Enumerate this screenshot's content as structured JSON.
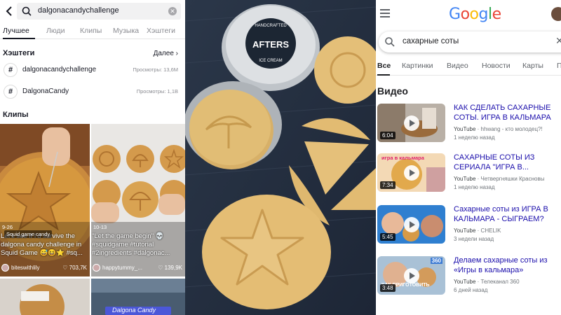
{
  "tiktok": {
    "search_query": "dalgonacandychallenge",
    "tabs": [
      "Лучшее",
      "Люди",
      "Клипы",
      "Музыка",
      "Хэштеги"
    ],
    "active_tab": "Лучшее",
    "hashtags_title": "Хэштеги",
    "more_label": "Далее",
    "hashtags": [
      {
        "name": "dalgonacandychallenge",
        "views": "Просмотры: 13,6M"
      },
      {
        "name": "DalgonaCandy",
        "views": "Просмотры: 1,1B"
      }
    ],
    "clips_title": "Клипы",
    "clips": [
      {
        "date": "9-26",
        "tag": "Squid game candy",
        "caption": "Let's see if I'd survive the dalgona candy challenge in Squid Game 😅😆⭐ #sq...",
        "user": "biteswithlily",
        "likes": "703,7K"
      },
      {
        "date": "10-13",
        "caption": "\"Let the game begin\" 💀 #squidgame #tutorial #2ingredients #dalgonac...",
        "user": "happytummy_...",
        "likes": "139,9K"
      }
    ],
    "clip_bottom_text": "Dalgona Candy"
  },
  "photo": {
    "tin_lid_line1": "HANDCRAFTED",
    "tin_lid_brand": "AFTERS",
    "tin_lid_line2": "ICE CREAM"
  },
  "google": {
    "logo_letters": [
      {
        "ch": "G",
        "color": "#4285F4"
      },
      {
        "ch": "o",
        "color": "#EA4335"
      },
      {
        "ch": "o",
        "color": "#FBBC05"
      },
      {
        "ch": "g",
        "color": "#4285F4"
      },
      {
        "ch": "l",
        "color": "#34A853"
      },
      {
        "ch": "e",
        "color": "#EA4335"
      }
    ],
    "search_query": "сахарные соты",
    "tabs": [
      "Все",
      "Картинки",
      "Видео",
      "Новости",
      "Карты",
      "П"
    ],
    "active_tab": "Все",
    "videos_title": "Видео",
    "videos": [
      {
        "title": "КАК СДЕЛАТЬ САХАРНЫЕ СОТЫ. ИГРА В КАЛЬМАРА",
        "source": "YouTube",
        "channel": "hhwang - кто молодец?!",
        "age": "1 неделю назад",
        "duration": "6:04"
      },
      {
        "title": "САХАРНЫЕ СОТЫ ИЗ СЕРИАЛА \"ИГРА В...",
        "source": "YouTube",
        "channel": "Четвергняшки Красновы",
        "age": "1 неделю назад",
        "duration": "7:34",
        "overlay_text": "игра в кальмара"
      },
      {
        "title": "Сахарные соты из ИГРА В КАЛЬМАРА - СЫГРАЕМ?",
        "source": "YouTube",
        "channel": "CHELIK",
        "age": "3 недели назад",
        "duration": "5:45"
      },
      {
        "title": "Делаем сахарные соты из «Игры в кальмара»",
        "source": "YouTube",
        "channel": "Телеканал 360",
        "age": "6 дней назад",
        "duration": "3:48",
        "overlay_text": "КАК ПРИГОТОВИТЬ",
        "badge": "360"
      }
    ]
  }
}
